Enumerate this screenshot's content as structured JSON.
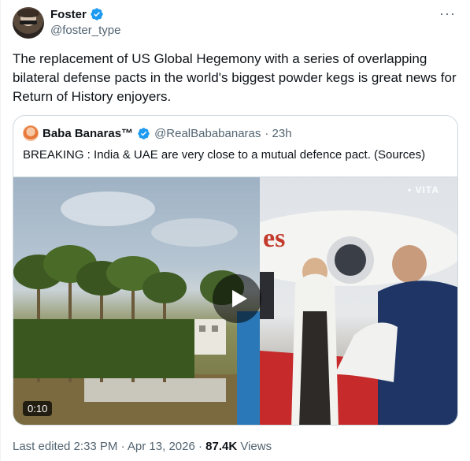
{
  "author": {
    "display_name": "Foster",
    "handle": "@foster_type",
    "verified": true
  },
  "more_icon": "···",
  "tweet_text": "The replacement of US Global Hegemony with a series of overlapping bilateral defense pacts in the world's biggest powder kegs is great news for Return of History enjoyers.",
  "quoted_tweet": {
    "display_name": "Baba Banaras™",
    "handle": "@RealBababanaras",
    "time": "· 23h",
    "text": "BREAKING : India & UAE are very close to a mutual defence pact. (Sources)",
    "media": {
      "duration": "0:10",
      "watermark": "• VITA",
      "play_icon": "play-icon"
    }
  },
  "meta": {
    "edited_label": "Last edited 2:33 PM · Apr 13, 2026 ·",
    "views_count": "87.4K",
    "views_label": "Views"
  },
  "colors": {
    "verified": "#1d9bf0",
    "secondary_text": "#536471",
    "border": "#cfd9de"
  }
}
